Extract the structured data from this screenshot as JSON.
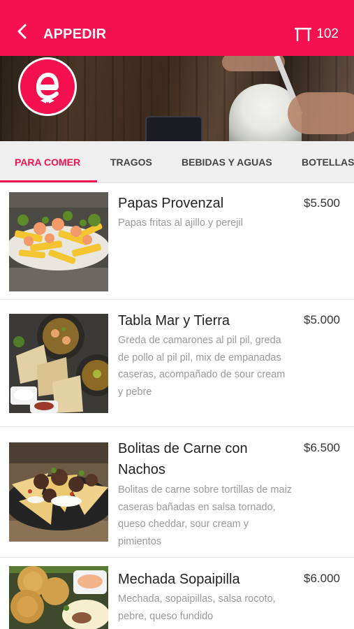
{
  "header": {
    "title": "APPEDIR",
    "back_icon": "chevron-left-icon",
    "table_icon": "table-icon",
    "table_number": "102",
    "background_color": "#f5114f"
  },
  "logo": {
    "icon": "appedir-logo-icon"
  },
  "tabs": [
    {
      "label": "PARA COMER",
      "active": true
    },
    {
      "label": "TRAGOS",
      "active": false
    },
    {
      "label": "BEBIDAS Y AGUAS",
      "active": false
    },
    {
      "label": "BOTELLAS",
      "active": false
    }
  ],
  "menu_items": [
    {
      "name": "Papas Provenzal",
      "description": "Papas fritas al ajillo y perejil",
      "price": "$5.500"
    },
    {
      "name": "Tabla Mar y Tierra",
      "description": "Greda de camarones al pil pil, greda de pollo al pil pil, mix de empanadas caseras, acompañado de sour cream y pebre",
      "price": "$5.000"
    },
    {
      "name": "Bolitas de Carne con Nachos",
      "description": "Bolitas de carne sobre tortillas de maiz caseras bañadas en salsa tornado, queso cheddar, sour cream y pimientos",
      "price": "$6.500"
    },
    {
      "name": "Mechada Sopaipilla",
      "description": "Mechada, sopaipillas, salsa rocoto, pebre, queso fundido",
      "price": "$6.000"
    }
  ]
}
